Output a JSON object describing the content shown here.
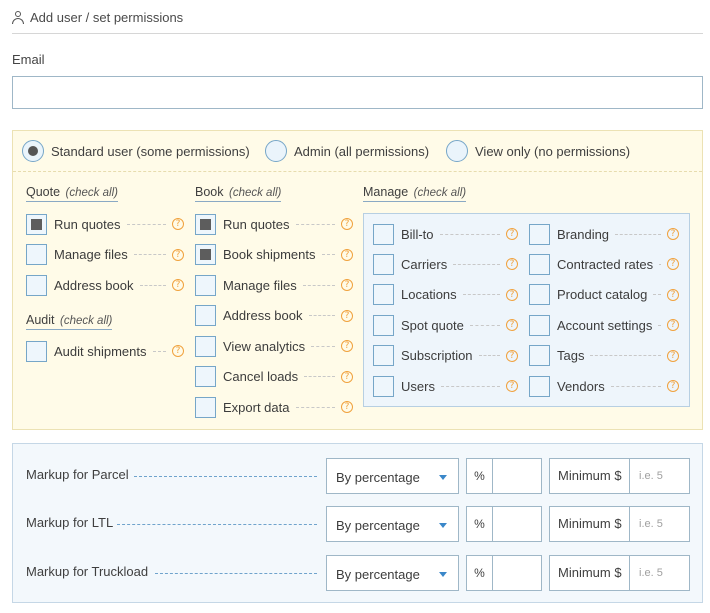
{
  "header": {
    "title": "Add user / set permissions",
    "icon": "user-icon"
  },
  "email": {
    "label": "Email",
    "value": "",
    "placeholder": ""
  },
  "roles": [
    {
      "label": "Standard user (some permissions)",
      "selected": true
    },
    {
      "label": "Admin (all permissions)",
      "selected": false
    },
    {
      "label": "View only (no permissions)",
      "selected": false
    }
  ],
  "check_all_label": "(check all)",
  "groups": {
    "quote": {
      "title": "Quote",
      "items": [
        {
          "label": "Run quotes",
          "checked": true
        },
        {
          "label": "Manage files",
          "checked": false
        },
        {
          "label": "Address book",
          "checked": false
        }
      ]
    },
    "audit": {
      "title": "Audit",
      "items": [
        {
          "label": "Audit shipments",
          "checked": false
        }
      ]
    },
    "book": {
      "title": "Book",
      "items": [
        {
          "label": "Run quotes",
          "checked": true
        },
        {
          "label": "Book shipments",
          "checked": true
        },
        {
          "label": "Manage files",
          "checked": false
        },
        {
          "label": "Address book",
          "checked": false
        },
        {
          "label": "View analytics",
          "checked": false
        },
        {
          "label": "Cancel loads",
          "checked": false
        },
        {
          "label": "Export data",
          "checked": false
        }
      ]
    },
    "manage": {
      "title": "Manage",
      "items": [
        {
          "label": "Bill-to",
          "checked": false
        },
        {
          "label": "Carriers",
          "checked": false
        },
        {
          "label": "Locations",
          "checked": false
        },
        {
          "label": "Spot quote",
          "checked": false
        },
        {
          "label": "Subscription",
          "checked": false
        },
        {
          "label": "Users",
          "checked": false
        },
        {
          "label": "Branding",
          "checked": false
        },
        {
          "label": "Contracted rates",
          "checked": false
        },
        {
          "label": "Product catalog",
          "checked": false
        },
        {
          "label": "Account settings",
          "checked": false
        },
        {
          "label": "Tags",
          "checked": false
        },
        {
          "label": "Vendors",
          "checked": false
        }
      ]
    }
  },
  "help_icon": "?",
  "markups": [
    {
      "label": "Markup for Parcel",
      "method": "By percentage",
      "percent_label": "%",
      "percent_value": "",
      "min_label": "Minimum $",
      "min_placeholder": "i.e. 5"
    },
    {
      "label": "Markup for LTL",
      "method": "By percentage",
      "percent_label": "%",
      "percent_value": "",
      "min_label": "Minimum $",
      "min_placeholder": "i.e. 5"
    },
    {
      "label": "Markup for Truckload",
      "method": "By percentage",
      "percent_label": "%",
      "percent_value": "",
      "min_label": "Minimum $",
      "min_placeholder": "i.e. 5"
    }
  ],
  "colors": {
    "accent": "#3a87c9",
    "checkbox_border": "#76a6c8",
    "help": "#f0a23e",
    "panel_yellow": "#fffbe8",
    "panel_blue": "#eef5fb"
  }
}
